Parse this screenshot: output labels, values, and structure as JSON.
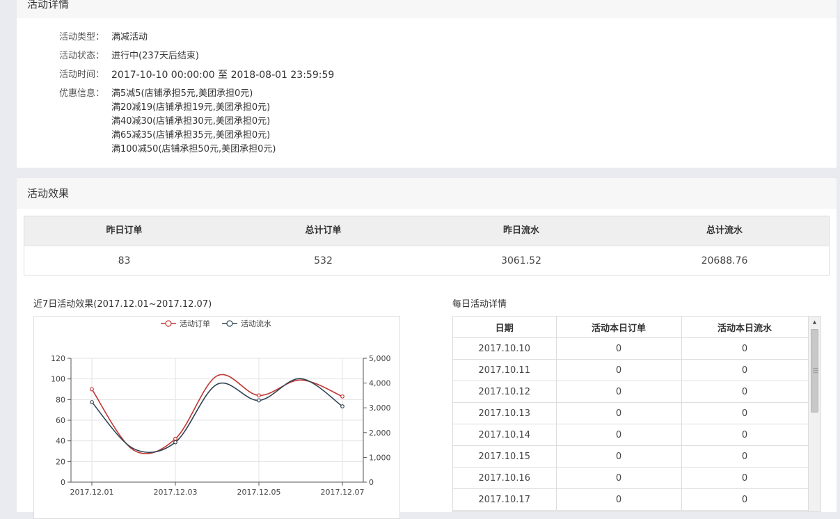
{
  "detail": {
    "title": "活动详情",
    "fields": [
      {
        "label": "活动类型：",
        "value": "满减活动"
      },
      {
        "label": "活动状态：",
        "value": "进行中(237天后结束)"
      },
      {
        "label": "活动时间：",
        "value": "2017-10-10 00:00:00 至 2018-08-01 23:59:59"
      }
    ],
    "discount_label": "优惠信息：",
    "discounts": [
      "满5减5(店铺承担5元,美团承担0元)",
      "满20减19(店铺承担19元,美团承担0元)",
      "满40减30(店铺承担30元,美团承担0元)",
      "满65减35(店铺承担35元,美团承担0元)",
      "满100减50(店铺承担50元,美团承担0元)"
    ]
  },
  "effect": {
    "title": "活动效果",
    "summary": {
      "headers": [
        "昨日订单",
        "总计订单",
        "昨日流水",
        "总计流水"
      ],
      "values": [
        "83",
        "532",
        "3061.52",
        "20688.76"
      ]
    },
    "chart_title": "近7日活动效果(2017.12.01~2017.12.07)",
    "table_title": "每日活动详情"
  },
  "chart_data": {
    "type": "line",
    "x": [
      "2017.12.01",
      "2017.12.02",
      "2017.12.03",
      "2017.12.04",
      "2017.12.05",
      "2017.12.06",
      "2017.12.07"
    ],
    "x_tick_labels": [
      "2017.12.01",
      "2017.12.03",
      "2017.12.05",
      "2017.12.07"
    ],
    "series": [
      {
        "name": "活动订单",
        "axis": "left",
        "color": "#c23531",
        "values": [
          90,
          31,
          42,
          103,
          84,
          99,
          83
        ]
      },
      {
        "name": "活动流水",
        "axis": "right",
        "color": "#2f4554",
        "values": [
          3230,
          1350,
          1610,
          3950,
          3300,
          4180,
          3060
        ]
      }
    ],
    "y_left": {
      "min": 0,
      "max": 120,
      "ticks": [
        "0",
        "20",
        "40",
        "60",
        "80",
        "100",
        "120"
      ]
    },
    "y_right": {
      "min": 0,
      "max": 5000,
      "ticks": [
        "0",
        "1,000",
        "2,000",
        "3,000",
        "4,000",
        "5,000"
      ]
    },
    "grid": true,
    "legend": "top-center"
  },
  "daily": {
    "headers": [
      "日期",
      "活动本日订单",
      "活动本日流水"
    ],
    "rows": [
      [
        "2017.10.10",
        "0",
        "0"
      ],
      [
        "2017.10.11",
        "0",
        "0"
      ],
      [
        "2017.10.12",
        "0",
        "0"
      ],
      [
        "2017.10.13",
        "0",
        "0"
      ],
      [
        "2017.10.14",
        "0",
        "0"
      ],
      [
        "2017.10.15",
        "0",
        "0"
      ],
      [
        "2017.10.16",
        "0",
        "0"
      ],
      [
        "2017.10.17",
        "0",
        "0"
      ]
    ]
  },
  "icons": {
    "scroll_up": "triangle-up-icon",
    "scroll_grip": "grip-lines-icon"
  }
}
